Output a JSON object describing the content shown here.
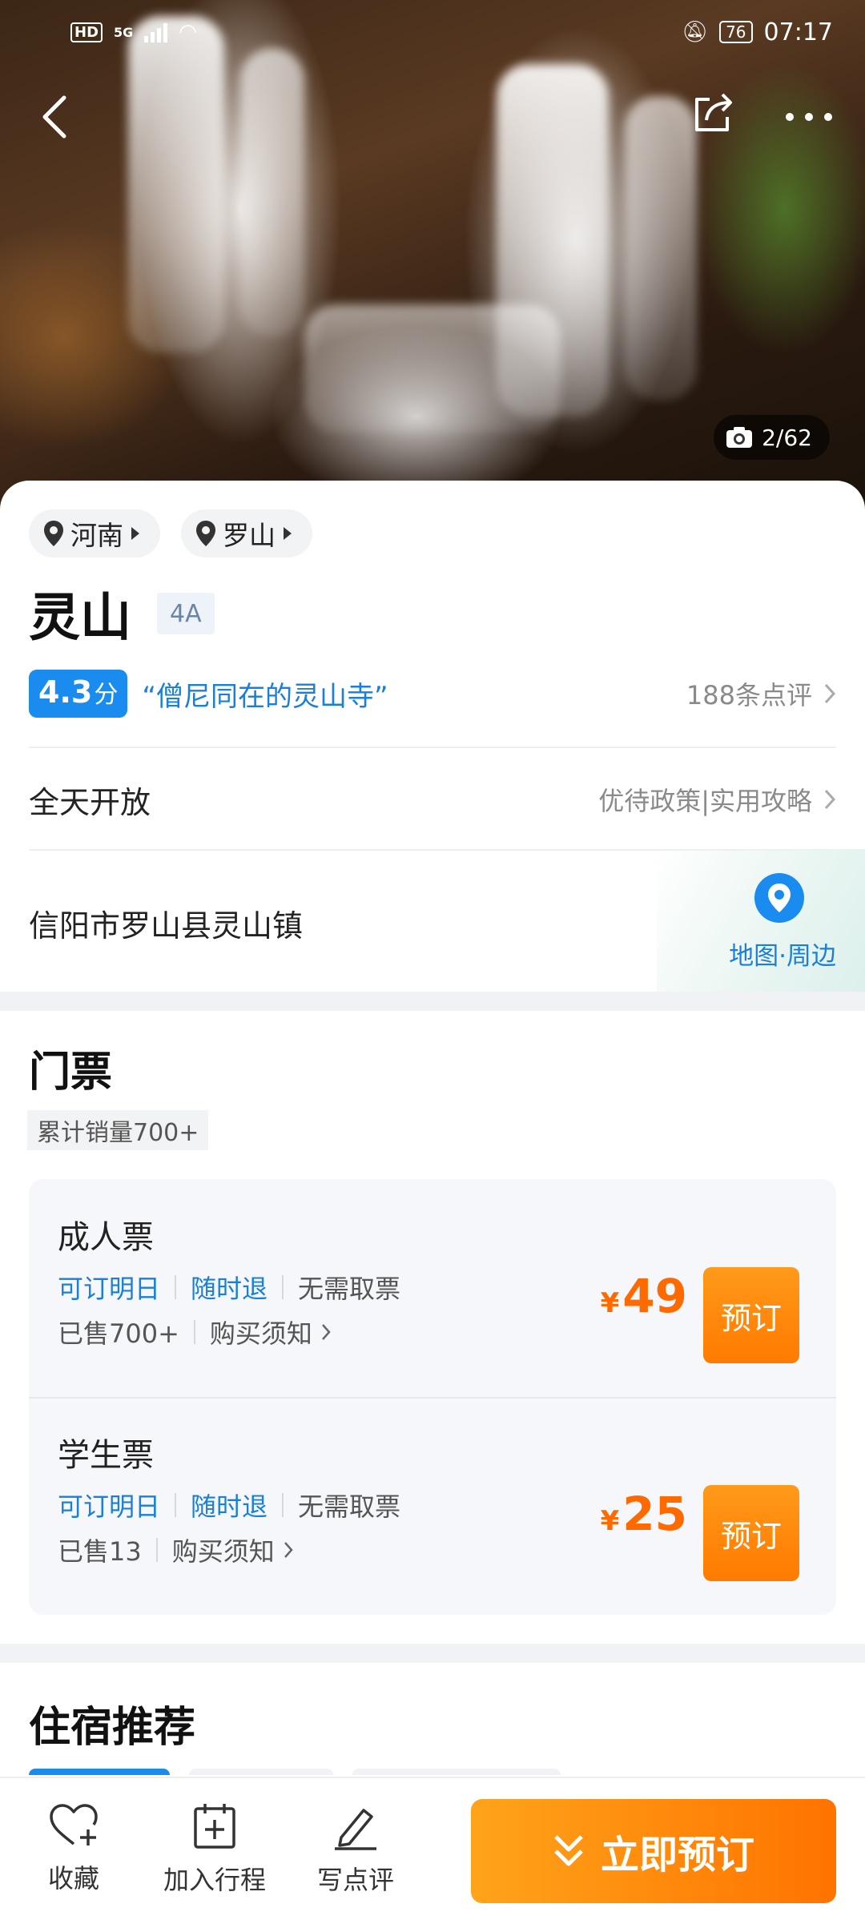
{
  "status_bar": {
    "network_hd": "HD",
    "network_gen": "5G",
    "battery": "76",
    "time": "07:17"
  },
  "hero": {
    "photo_counter": "2/62"
  },
  "location_chips": [
    {
      "label": "河南"
    },
    {
      "label": "罗山"
    }
  ],
  "attraction": {
    "name": "灵山",
    "grade": "4A",
    "score": "4.3",
    "score_unit": "分",
    "quote": "“僧尼同在的灵山寺”",
    "review_count": "188条点评",
    "hours": "全天开放",
    "policy_link": "优待政策|实用攻略",
    "address": "信阳市罗山县灵山镇",
    "map_link": "地图·周边"
  },
  "tickets_section": {
    "title": "门票",
    "total_sales": "累计销量700+",
    "items": [
      {
        "name": "成人票",
        "tag1": "可订明日",
        "tag2": "随时退",
        "tag3": "无需取票",
        "sold": "已售700+",
        "notice": "购买须知",
        "currency": "¥",
        "price": "49",
        "book_label": "预订"
      },
      {
        "name": "学生票",
        "tag1": "可订明日",
        "tag2": "随时退",
        "tag3": "无需取票",
        "sold": "已售13",
        "notice": "购买须知",
        "currency": "¥",
        "price": "25",
        "book_label": "预订"
      }
    ]
  },
  "lodging_section": {
    "title": "住宿推荐"
  },
  "bottom_bar": {
    "favorite": "收藏",
    "add_itinerary": "加入行程",
    "write_review": "写点评",
    "book_now": "立即预订"
  },
  "colors": {
    "accent_blue": "#1a8cf0",
    "accent_orange": "#ff7a00",
    "price_orange": "#ff6a00"
  },
  "icons": [
    "back-icon",
    "share-icon",
    "more-icon",
    "camera-icon",
    "location-pin-icon",
    "chevron-right-icon",
    "heart-plus-icon",
    "calendar-plus-icon",
    "pen-icon",
    "double-chevron-down-icon"
  ]
}
